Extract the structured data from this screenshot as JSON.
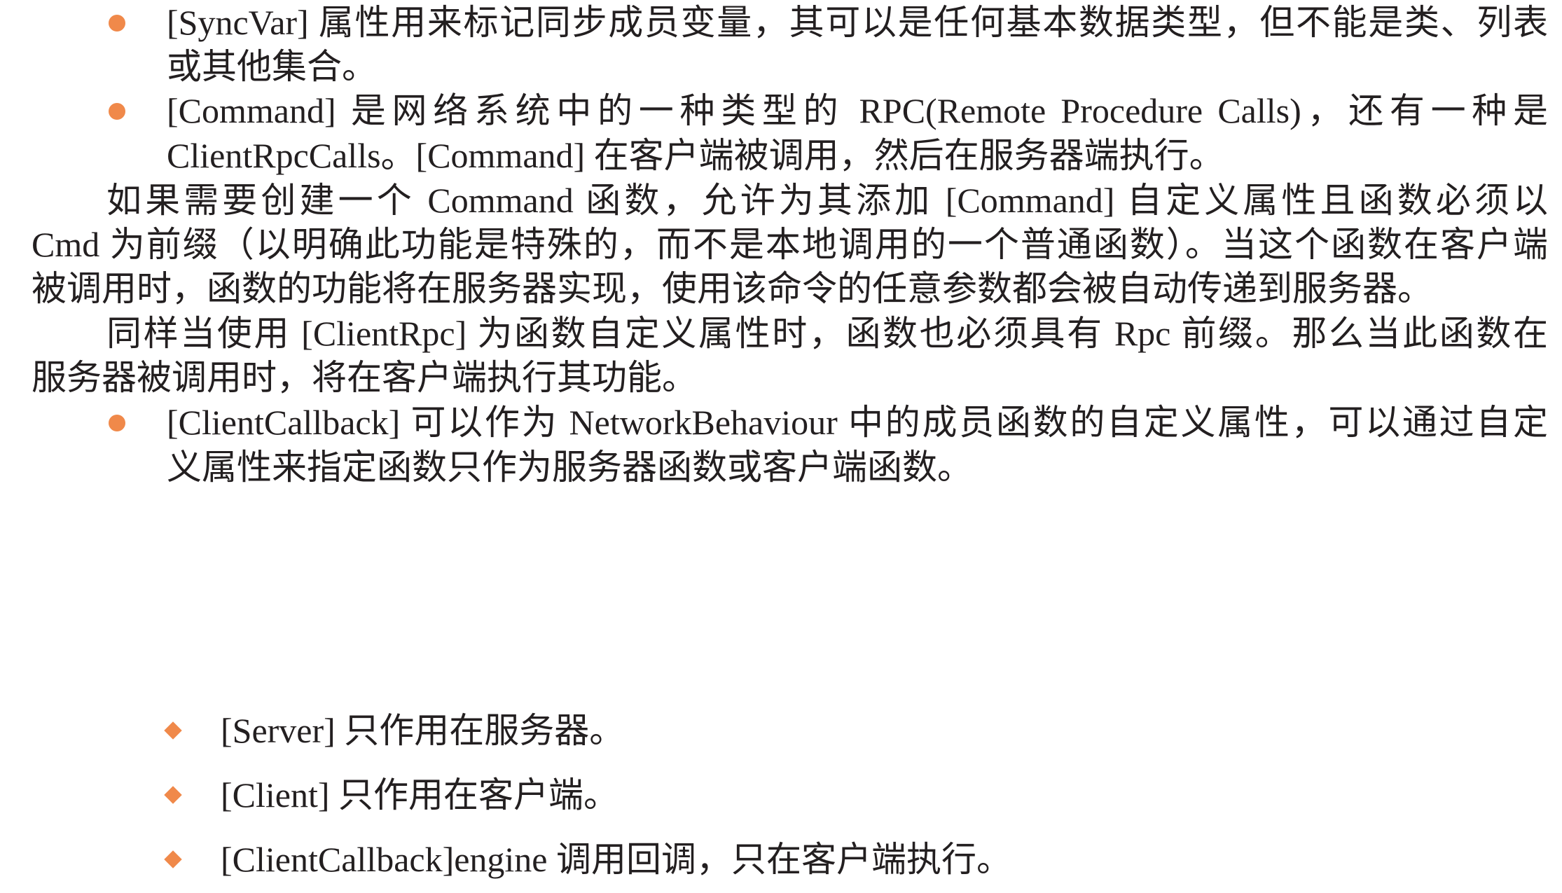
{
  "colors": {
    "bullet": "#f0894a",
    "text": "#231f20",
    "background": "#ffffff"
  },
  "bullets": {
    "level1_icon": "orange-dot-bullet-icon",
    "level2_icon": "orange-diamond-bullet-icon"
  },
  "content": {
    "syncvar": {
      "line1": "[SyncVar] 属性用来标记同步成员变量，其可以是任何基本数据类型，但不能是类、列表",
      "line2": "或其他集合。"
    },
    "command": {
      "line1": "[Command] 是网络系统中的一种类型的 RPC(Remote Procedure Calls)，还有一种是",
      "line2": "ClientRpcCalls。[Command] 在客户端被调用，然后在服务器端执行。"
    },
    "para1": {
      "line1": "如果需要创建一个 Command 函数，允许为其添加 [Command] 自定义属性且函数必须以",
      "line2": "Cmd 为前缀（以明确此功能是特殊的，而不是本地调用的一个普通函数）。当这个函数在客户端",
      "line3": "被调用时，函数的功能将在服务器实现，使用该命令的任意参数都会被自动传递到服务器。"
    },
    "para2": {
      "line1": "同样当使用 [ClientRpc] 为函数自定义属性时，函数也必须具有 Rpc 前缀。那么当此函数在",
      "line2": "服务器被调用时，将在客户端执行其功能。"
    },
    "clientcallback": {
      "line1": "[ClientCallback] 可以作为 NetworkBehaviour 中的成员函数的自定义属性，可以通过自定",
      "line2": "义属性来指定函数只作为服务器函数或客户端函数。"
    },
    "subitems": [
      "[Server] 只作用在服务器。",
      "[Client] 只作用在客户端。",
      "[ClientCallback]engine 调用回调，只在客户端执行。"
    ]
  }
}
